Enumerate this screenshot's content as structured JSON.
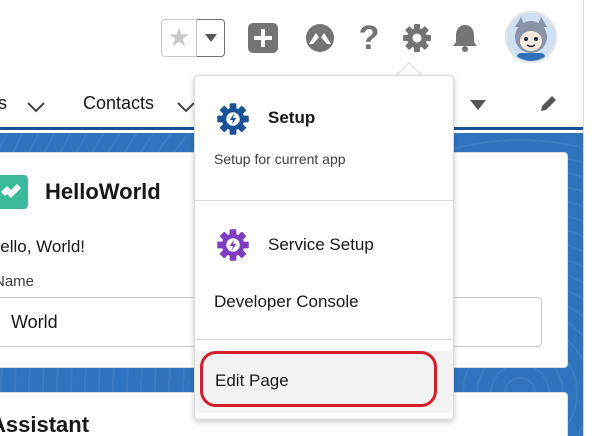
{
  "header": {
    "favorites_star_icon": "star-icon",
    "favorites_menu_icon": "chevron-down-icon",
    "icons": [
      "add-icon",
      "trailhead-icon",
      "help-icon",
      "gear-icon",
      "bell-icon",
      "avatar"
    ]
  },
  "nav": {
    "partial_item_label": "s",
    "contacts_label": "Contacts"
  },
  "card": {
    "title": "HelloWorld",
    "greeting": "Hello, World!",
    "name_label": "Name",
    "name_value": "World"
  },
  "card2": {
    "title": "Assistant"
  },
  "setup_menu": {
    "setup_label": "Setup",
    "setup_description": "Setup for current app",
    "service_setup_label": "Service Setup",
    "developer_console_label": "Developer Console",
    "edit_page_label": "Edit Page"
  },
  "colors": {
    "brand_blue": "#1b5297",
    "page_background": "#2f73be",
    "setup_icon": "#1b5297",
    "service_icon": "#7f3ec2",
    "highlight": "#d51e2a",
    "helloworld_icon": "#3bba9c"
  }
}
